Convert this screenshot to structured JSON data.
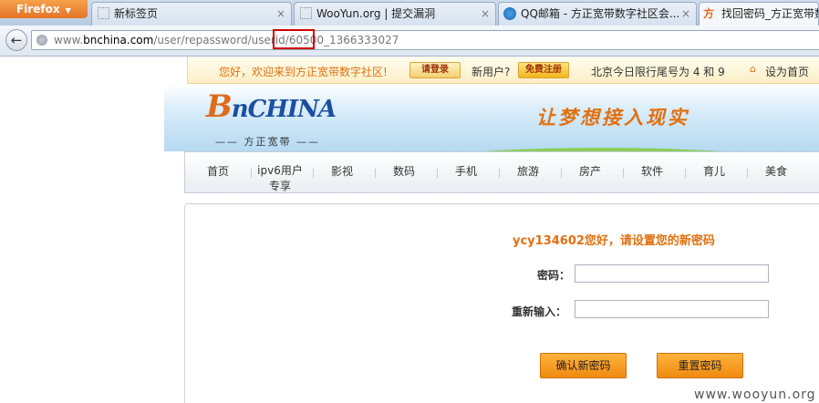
{
  "browser": {
    "app_button": "Firefox",
    "tabs": [
      {
        "title": "新标签页",
        "close": "×"
      },
      {
        "title": "WooYun.org | 提交漏洞",
        "close": "×"
      },
      {
        "title": "QQ邮箱 - 方正宽带数字社区会...",
        "close": "×"
      },
      {
        "title": "找回密码_方正宽带数",
        "favicon": "方",
        "close": ""
      }
    ],
    "url": {
      "scheme": "www.",
      "host": "bnchina.com",
      "path": "/user/repassword/userid/60500_1366333027"
    }
  },
  "site": {
    "welcome": "您好，欢迎来到方正宽带数字社区!",
    "login_button": "请登录",
    "new_user": "新用户?",
    "register_button": "免费注册",
    "traffic_notice": "北京今日限行尾号为 4 和 9",
    "set_home": "设为首页",
    "logo_b": "B",
    "logo_rest": "nCHINA",
    "logo_sub": "—— 方正宽带 ——",
    "slogan": "让梦想接入现实",
    "menu": [
      "首页",
      "ipv6用户专享",
      "影视",
      "数码",
      "手机",
      "旅游",
      "房产",
      "软件",
      "育儿",
      "美食"
    ]
  },
  "form": {
    "greeting": "ycy134602您好，请设置您的新密码",
    "password_label": "密码：",
    "password_value": "",
    "confirm_label": "重新输入：",
    "confirm_value": "",
    "submit_button": "确认新密码",
    "reset_button": "重置密码"
  },
  "watermark": "www.wooyun.org",
  "colors": {
    "accent": "#e07010",
    "highlight_box": "#d40000",
    "button": "#f08a10"
  }
}
